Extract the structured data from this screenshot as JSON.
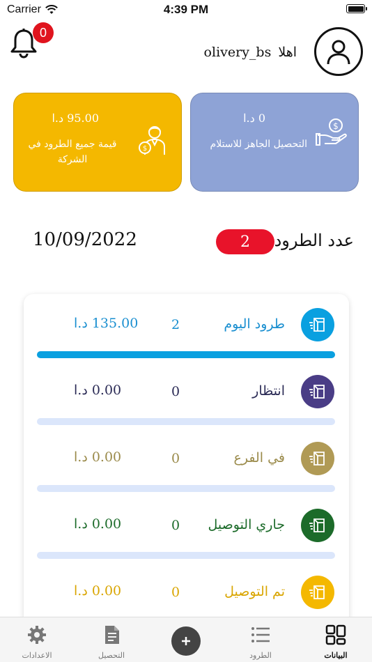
{
  "status_bar": {
    "carrier": "Carrier",
    "time": "4:39 PM"
  },
  "header": {
    "notification_count": "0",
    "greeting": "اهلا",
    "username": "olivery_bs"
  },
  "cards": {
    "collection": {
      "amount": "0 د.ا",
      "label": "التحصيل الجاهز للاستلام",
      "color": "#8ea3d6",
      "icon": "money-hand-icon"
    },
    "parcels_value": {
      "amount": "95.00 د.ا",
      "label": "قيمة جميع الطرود في الشركة",
      "color": "#f4b800",
      "icon": "agent-coin-icon"
    }
  },
  "summary": {
    "date": "10/09/2022",
    "count_label": "عدد الطرود",
    "count": "2"
  },
  "rows": [
    {
      "label": "طرود اليوم",
      "count": "2",
      "amount": "135.00 د.ا",
      "color": "#0aa0e0",
      "text_color": "#1a8fd0",
      "progress": 1
    },
    {
      "label": "انتظار",
      "count": "0",
      "amount": "0.00 د.ا",
      "color": "#4a3d86",
      "text_color": "#2a2a55",
      "progress": 0
    },
    {
      "label": "في الفرع",
      "count": "0",
      "amount": "0.00 د.ا",
      "color": "#b09a55",
      "text_color": "#9a8a4a",
      "progress": 0
    },
    {
      "label": "جاري التوصيل",
      "count": "0",
      "amount": "0.00 د.ا",
      "color": "#1c6b2a",
      "text_color": "#1c6b2a",
      "progress": 0
    },
    {
      "label": "تم التوصيل",
      "count": "0",
      "amount": "0.00 د.ا",
      "color": "#f4b800",
      "text_color": "#d9a500",
      "progress": 0
    }
  ],
  "tabbar": {
    "data": "البيانات",
    "parcels": "الطرود",
    "collection": "التحصيل",
    "settings": "الاعدادات"
  }
}
